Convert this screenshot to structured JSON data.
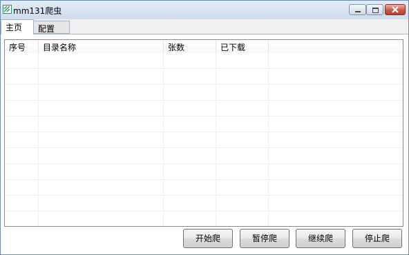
{
  "window": {
    "title": "mm131爬虫",
    "icon": "app-icon",
    "controls": [
      "minimize-icon",
      "maximize-icon",
      "close-icon"
    ]
  },
  "tabs": [
    {
      "label": "主页",
      "active": true
    },
    {
      "label": "配置",
      "active": false
    }
  ],
  "table": {
    "columns": [
      "序号",
      "目录名称",
      "张数",
      "已下载",
      ""
    ],
    "rows": []
  },
  "buttons": {
    "start": "开始爬",
    "pause": "暂停爬",
    "continue": "继续爬",
    "stop": "停止爬"
  },
  "colors": {
    "titlebar": "#d7e3f2",
    "close_button": "#c85a48",
    "panel": "#ffffff",
    "grid_line": "#f0f0f0"
  }
}
